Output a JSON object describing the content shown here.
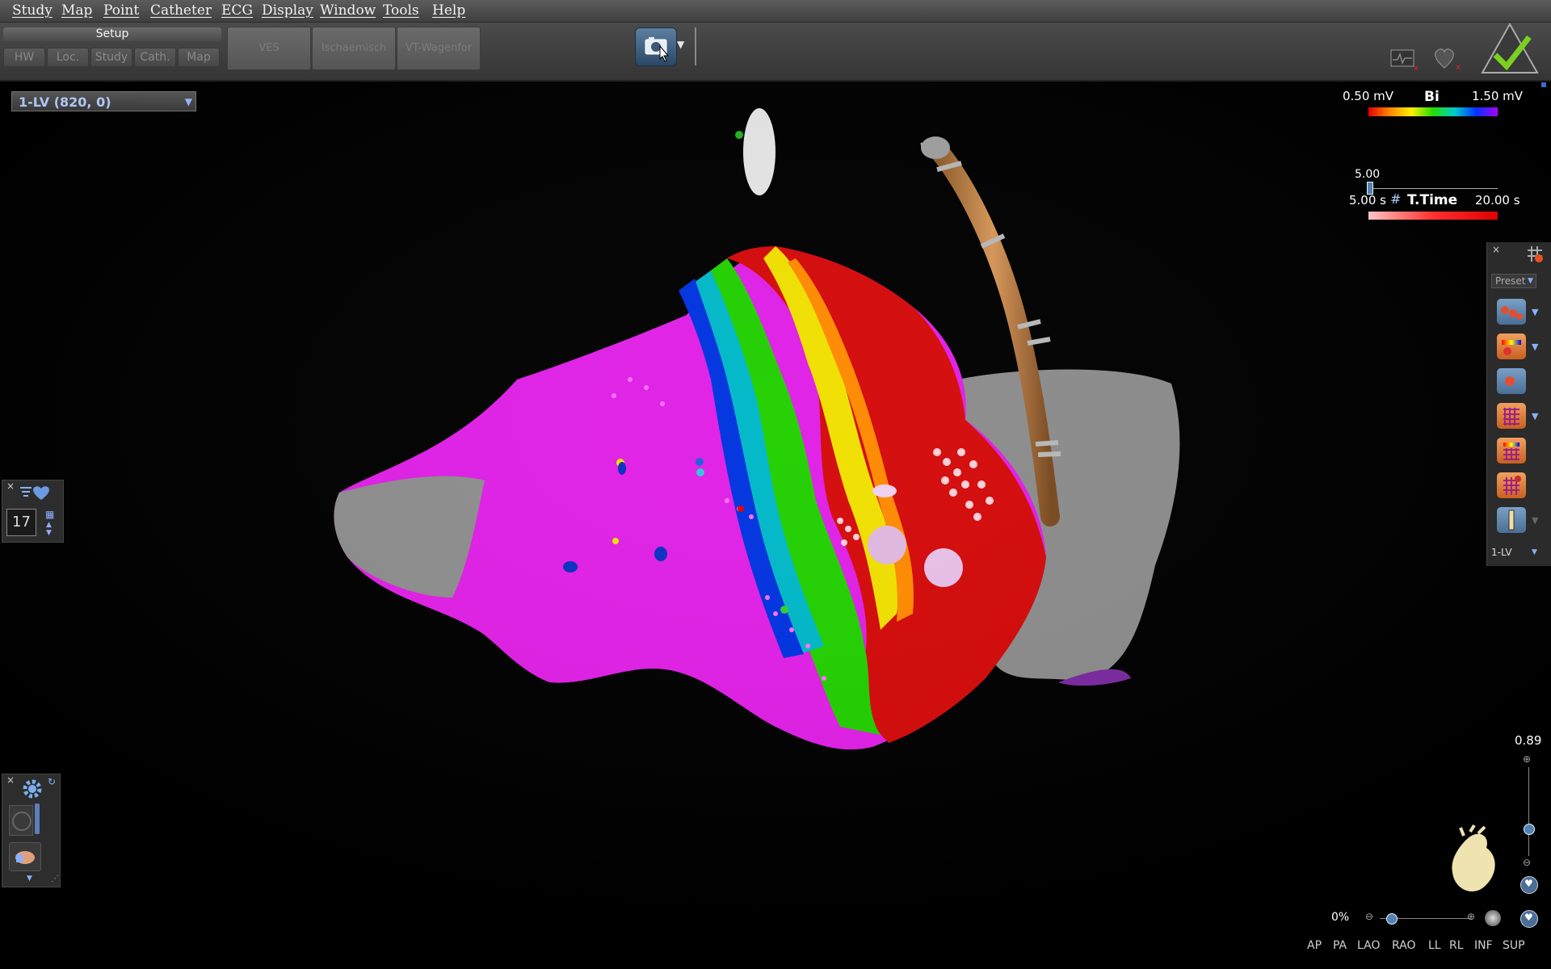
{
  "menu": {
    "items": [
      "Study",
      "Map",
      "Point",
      "Catheter",
      "ECG",
      "Display",
      "Window",
      "Tools",
      "Help"
    ]
  },
  "toolbar": {
    "setup_label": "Setup",
    "setup_buttons": [
      "HW",
      "Loc.",
      "Study",
      "Cath.",
      "Map"
    ],
    "tabs": [
      "VES",
      "Ischaemisch",
      "VT-Wagenfor"
    ],
    "snapshot_icon": "camera-icon"
  },
  "map_selector": {
    "value": "1-LV (820, 0)"
  },
  "legend_bi": {
    "min": "0.50 mV",
    "label": "Bi",
    "max": "1.50 mV"
  },
  "legend_ttime": {
    "slider_value": "5.00",
    "min": "5.00 s",
    "label": "T.Time",
    "max": "20.00 s"
  },
  "right_panel": {
    "preset_label": "Preset",
    "map_label": "1-LV",
    "tools": [
      "points-icon",
      "color-map-icon",
      "point-icon",
      "grid-icon",
      "color-grid-icon",
      "dot-grid-icon",
      "catheter-icon"
    ]
  },
  "left_widget": {
    "count": "17"
  },
  "zoom": {
    "value": "0.89",
    "opacity": "0%"
  },
  "views": [
    "AP",
    "PA",
    "LAO",
    "RAO",
    "LL",
    "RL",
    "INF",
    "SUP"
  ],
  "colors": {
    "accent": "#5a7fb8",
    "panel": "#2b2b2b"
  }
}
